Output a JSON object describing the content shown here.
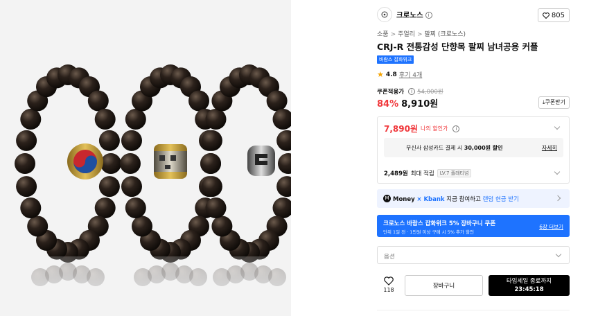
{
  "brand": {
    "name": "크로노스",
    "like_count": "805"
  },
  "breadcrumb": [
    "소품",
    "주얼리",
    "팔찌 (크로노스)"
  ],
  "product": {
    "title": "CRJ-R 전통감성 단향목 팔찌 남녀공용 커플",
    "badge": "바람스 잡화위크",
    "rating": "4.8",
    "reviews": "후기 4개"
  },
  "price": {
    "coupon_label": "쿠폰적용가",
    "original": "54,000원",
    "discount": "84%",
    "final": "8,910원",
    "coupon_button": "쿠폰받기"
  },
  "benefit": {
    "my_price": "7,890원",
    "my_price_label": "나의 할인가",
    "card_text_prefix": "무신사 삼성카드 결제 시",
    "card_text_bold": "30,000원 할인",
    "card_more": "자세히",
    "points_amount": "2,489원",
    "points_label": "최대 적립",
    "level": "LV.7 플래티넘"
  },
  "money": {
    "brand": "Money",
    "partner": "× Kbank",
    "text": "지금 참여하고",
    "highlight": "랜덤 현금 받기"
  },
  "promo": {
    "line1": "크로노스 바람스 잡화위크 5% 장바구니 쿠폰",
    "line2": "단위 1일 전 · 1만원 이상 구매 시 5% 추가 할인",
    "more": "6장 더보기"
  },
  "option": {
    "placeholder": "옵션"
  },
  "actions": {
    "wish_count": "118",
    "cart": "장바구니",
    "buy_line1": "타임세일 종료까지",
    "buy_time": "23:45:18"
  },
  "colors": {
    "accent_blue": "#1e73ff",
    "sale_red": "#f0373b",
    "star": "#f5a300"
  }
}
